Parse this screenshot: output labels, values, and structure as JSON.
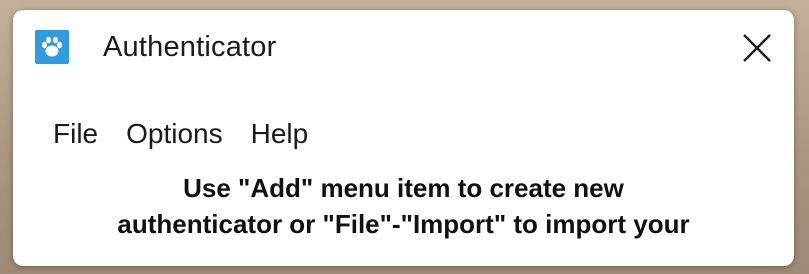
{
  "window": {
    "title": "Authenticator",
    "icon": "paw-icon",
    "close_icon": "close-icon",
    "accent_color": "#2f9be0"
  },
  "menu": {
    "items": [
      {
        "label": "File"
      },
      {
        "label": "Options"
      },
      {
        "label": "Help"
      }
    ]
  },
  "message": {
    "line1": "Use \"Add\" menu item to create new",
    "line2": "authenticator or \"File\"-\"Import\" to import your"
  }
}
